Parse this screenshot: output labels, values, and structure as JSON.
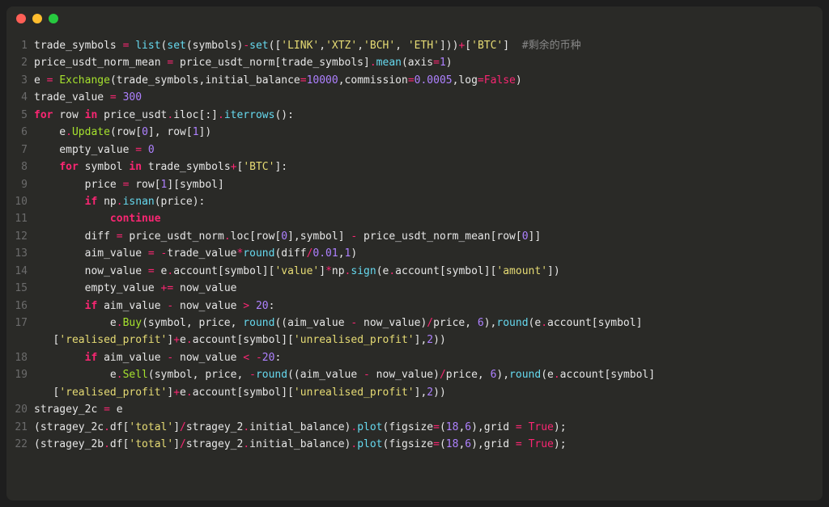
{
  "window": {
    "traffic_lights": [
      "red",
      "yellow",
      "green"
    ]
  },
  "code": {
    "lines": [
      {
        "n": "1",
        "tokens": [
          [
            "var",
            "trade_symbols "
          ],
          [
            "op",
            "="
          ],
          [
            "var",
            " "
          ],
          [
            "func",
            "list"
          ],
          [
            "var",
            "("
          ],
          [
            "func",
            "set"
          ],
          [
            "var",
            "(symbols)"
          ],
          [
            "op",
            "-"
          ],
          [
            "func",
            "set"
          ],
          [
            "var",
            "(["
          ],
          [
            "str",
            "'LINK'"
          ],
          [
            "var",
            ","
          ],
          [
            "str",
            "'XTZ'"
          ],
          [
            "var",
            ","
          ],
          [
            "str",
            "'BCH'"
          ],
          [
            "var",
            ", "
          ],
          [
            "str",
            "'ETH'"
          ],
          [
            "var",
            "]))"
          ],
          [
            "op",
            "+"
          ],
          [
            "var",
            "["
          ],
          [
            "str",
            "'BTC'"
          ],
          [
            "var",
            "]  "
          ],
          [
            "cmnt",
            "#剩余的币种"
          ]
        ]
      },
      {
        "n": "2",
        "tokens": [
          [
            "var",
            "price_usdt_norm_mean "
          ],
          [
            "op",
            "="
          ],
          [
            "var",
            " price_usdt_norm[trade_symbols]"
          ],
          [
            "op",
            "."
          ],
          [
            "func",
            "mean"
          ],
          [
            "var",
            "(axis"
          ],
          [
            "op",
            "="
          ],
          [
            "num",
            "1"
          ],
          [
            "var",
            ")"
          ]
        ]
      },
      {
        "n": "3",
        "tokens": [
          [
            "var",
            "e "
          ],
          [
            "op",
            "="
          ],
          [
            "var",
            " "
          ],
          [
            "class",
            "Exchange"
          ],
          [
            "var",
            "(trade_symbols,initial_balance"
          ],
          [
            "op",
            "="
          ],
          [
            "num",
            "10000"
          ],
          [
            "var",
            ",commission"
          ],
          [
            "op",
            "="
          ],
          [
            "num",
            "0.0005"
          ],
          [
            "var",
            ",log"
          ],
          [
            "op",
            "="
          ],
          [
            "const",
            "False"
          ],
          [
            "var",
            ")"
          ]
        ]
      },
      {
        "n": "4",
        "tokens": [
          [
            "var",
            "trade_value "
          ],
          [
            "op",
            "="
          ],
          [
            "var",
            " "
          ],
          [
            "num",
            "300"
          ]
        ]
      },
      {
        "n": "5",
        "tokens": [
          [
            "kw",
            "for"
          ],
          [
            "var",
            " row "
          ],
          [
            "kw",
            "in"
          ],
          [
            "var",
            " price_usdt"
          ],
          [
            "op",
            "."
          ],
          [
            "var",
            "iloc[:]"
          ],
          [
            "op",
            "."
          ],
          [
            "func",
            "iterrows"
          ],
          [
            "var",
            "():"
          ]
        ]
      },
      {
        "n": "6",
        "tokens": [
          [
            "var",
            "    e"
          ],
          [
            "op",
            "."
          ],
          [
            "class",
            "Update"
          ],
          [
            "var",
            "(row["
          ],
          [
            "num",
            "0"
          ],
          [
            "var",
            "], row["
          ],
          [
            "num",
            "1"
          ],
          [
            "var",
            "])"
          ]
        ]
      },
      {
        "n": "7",
        "tokens": [
          [
            "var",
            "    empty_value "
          ],
          [
            "op",
            "="
          ],
          [
            "var",
            " "
          ],
          [
            "num",
            "0"
          ]
        ]
      },
      {
        "n": "8",
        "tokens": [
          [
            "var",
            "    "
          ],
          [
            "kw",
            "for"
          ],
          [
            "var",
            " symbol "
          ],
          [
            "kw",
            "in"
          ],
          [
            "var",
            " trade_symbols"
          ],
          [
            "op",
            "+"
          ],
          [
            "var",
            "["
          ],
          [
            "str",
            "'BTC'"
          ],
          [
            "var",
            "]:"
          ]
        ]
      },
      {
        "n": "9",
        "tokens": [
          [
            "var",
            "        price "
          ],
          [
            "op",
            "="
          ],
          [
            "var",
            " row["
          ],
          [
            "num",
            "1"
          ],
          [
            "var",
            "][symbol]"
          ]
        ]
      },
      {
        "n": "10",
        "tokens": [
          [
            "var",
            "        "
          ],
          [
            "kw",
            "if"
          ],
          [
            "var",
            " np"
          ],
          [
            "op",
            "."
          ],
          [
            "func",
            "isnan"
          ],
          [
            "var",
            "(price):"
          ]
        ]
      },
      {
        "n": "11",
        "tokens": [
          [
            "var",
            "            "
          ],
          [
            "kw",
            "continue"
          ]
        ]
      },
      {
        "n": "12",
        "tokens": [
          [
            "var",
            "        diff "
          ],
          [
            "op",
            "="
          ],
          [
            "var",
            " price_usdt_norm"
          ],
          [
            "op",
            "."
          ],
          [
            "var",
            "loc[row["
          ],
          [
            "num",
            "0"
          ],
          [
            "var",
            "],symbol] "
          ],
          [
            "op",
            "-"
          ],
          [
            "var",
            " price_usdt_norm_mean[row["
          ],
          [
            "num",
            "0"
          ],
          [
            "var",
            "]]"
          ]
        ]
      },
      {
        "n": "13",
        "tokens": [
          [
            "var",
            "        aim_value "
          ],
          [
            "op",
            "="
          ],
          [
            "var",
            " "
          ],
          [
            "op",
            "-"
          ],
          [
            "var",
            "trade_value"
          ],
          [
            "op",
            "*"
          ],
          [
            "func",
            "round"
          ],
          [
            "var",
            "(diff"
          ],
          [
            "op",
            "/"
          ],
          [
            "num",
            "0.01"
          ],
          [
            "var",
            ","
          ],
          [
            "num",
            "1"
          ],
          [
            "var",
            ")"
          ]
        ]
      },
      {
        "n": "14",
        "tokens": [
          [
            "var",
            "        now_value "
          ],
          [
            "op",
            "="
          ],
          [
            "var",
            " e"
          ],
          [
            "op",
            "."
          ],
          [
            "var",
            "account[symbol]["
          ],
          [
            "str",
            "'value'"
          ],
          [
            "var",
            "]"
          ],
          [
            "op",
            "*"
          ],
          [
            "var",
            "np"
          ],
          [
            "op",
            "."
          ],
          [
            "func",
            "sign"
          ],
          [
            "var",
            "(e"
          ],
          [
            "op",
            "."
          ],
          [
            "var",
            "account[symbol]["
          ],
          [
            "str",
            "'amount'"
          ],
          [
            "var",
            "])"
          ]
        ]
      },
      {
        "n": "15",
        "tokens": [
          [
            "var",
            "        empty_value "
          ],
          [
            "op",
            "+="
          ],
          [
            "var",
            " now_value"
          ]
        ]
      },
      {
        "n": "16",
        "tokens": [
          [
            "var",
            "        "
          ],
          [
            "kw",
            "if"
          ],
          [
            "var",
            " aim_value "
          ],
          [
            "op",
            "-"
          ],
          [
            "var",
            " now_value "
          ],
          [
            "op",
            ">"
          ],
          [
            "var",
            " "
          ],
          [
            "num",
            "20"
          ],
          [
            "var",
            ":"
          ]
        ]
      },
      {
        "n": "17",
        "tokens": [
          [
            "var",
            "            e"
          ],
          [
            "op",
            "."
          ],
          [
            "class",
            "Buy"
          ],
          [
            "var",
            "(symbol, price, "
          ],
          [
            "func",
            "round"
          ],
          [
            "var",
            "((aim_value "
          ],
          [
            "op",
            "-"
          ],
          [
            "var",
            " now_value)"
          ],
          [
            "op",
            "/"
          ],
          [
            "var",
            "price, "
          ],
          [
            "num",
            "6"
          ],
          [
            "var",
            "),"
          ],
          [
            "func",
            "round"
          ],
          [
            "var",
            "(e"
          ],
          [
            "op",
            "."
          ],
          [
            "var",
            "account[symbol]"
          ]
        ]
      },
      {
        "n": "",
        "tokens": [
          [
            "var",
            "   ["
          ],
          [
            "str",
            "'realised_profit'"
          ],
          [
            "var",
            "]"
          ],
          [
            "op",
            "+"
          ],
          [
            "var",
            "e"
          ],
          [
            "op",
            "."
          ],
          [
            "var",
            "account[symbol]["
          ],
          [
            "str",
            "'unrealised_profit'"
          ],
          [
            "var",
            "],"
          ],
          [
            "num",
            "2"
          ],
          [
            "var",
            "))"
          ]
        ]
      },
      {
        "n": "18",
        "tokens": [
          [
            "var",
            "        "
          ],
          [
            "kw",
            "if"
          ],
          [
            "var",
            " aim_value "
          ],
          [
            "op",
            "-"
          ],
          [
            "var",
            " now_value "
          ],
          [
            "op",
            "<"
          ],
          [
            "var",
            " "
          ],
          [
            "op",
            "-"
          ],
          [
            "num",
            "20"
          ],
          [
            "var",
            ":"
          ]
        ]
      },
      {
        "n": "19",
        "tokens": [
          [
            "var",
            "            e"
          ],
          [
            "op",
            "."
          ],
          [
            "class",
            "Sell"
          ],
          [
            "var",
            "(symbol, price, "
          ],
          [
            "op",
            "-"
          ],
          [
            "func",
            "round"
          ],
          [
            "var",
            "((aim_value "
          ],
          [
            "op",
            "-"
          ],
          [
            "var",
            " now_value)"
          ],
          [
            "op",
            "/"
          ],
          [
            "var",
            "price, "
          ],
          [
            "num",
            "6"
          ],
          [
            "var",
            "),"
          ],
          [
            "func",
            "round"
          ],
          [
            "var",
            "(e"
          ],
          [
            "op",
            "."
          ],
          [
            "var",
            "account[symbol]"
          ]
        ]
      },
      {
        "n": "",
        "tokens": [
          [
            "var",
            "   ["
          ],
          [
            "str",
            "'realised_profit'"
          ],
          [
            "var",
            "]"
          ],
          [
            "op",
            "+"
          ],
          [
            "var",
            "e"
          ],
          [
            "op",
            "."
          ],
          [
            "var",
            "account[symbol]["
          ],
          [
            "str",
            "'unrealised_profit'"
          ],
          [
            "var",
            "],"
          ],
          [
            "num",
            "2"
          ],
          [
            "var",
            "))"
          ]
        ]
      },
      {
        "n": "20",
        "tokens": [
          [
            "var",
            "stragey_2c "
          ],
          [
            "op",
            "="
          ],
          [
            "var",
            " e"
          ]
        ]
      },
      {
        "n": "21",
        "tokens": [
          [
            "var",
            "(stragey_2c"
          ],
          [
            "op",
            "."
          ],
          [
            "var",
            "df["
          ],
          [
            "str",
            "'total'"
          ],
          [
            "var",
            "]"
          ],
          [
            "op",
            "/"
          ],
          [
            "var",
            "stragey_2"
          ],
          [
            "op",
            "."
          ],
          [
            "var",
            "initial_balance)"
          ],
          [
            "op",
            "."
          ],
          [
            "func",
            "plot"
          ],
          [
            "var",
            "(figsize"
          ],
          [
            "op",
            "="
          ],
          [
            "var",
            "("
          ],
          [
            "num",
            "18"
          ],
          [
            "var",
            ","
          ],
          [
            "num",
            "6"
          ],
          [
            "var",
            "),grid "
          ],
          [
            "op",
            "="
          ],
          [
            "var",
            " "
          ],
          [
            "const",
            "True"
          ],
          [
            "var",
            ");"
          ]
        ]
      },
      {
        "n": "22",
        "tokens": [
          [
            "var",
            "(stragey_2b"
          ],
          [
            "op",
            "."
          ],
          [
            "var",
            "df["
          ],
          [
            "str",
            "'total'"
          ],
          [
            "var",
            "]"
          ],
          [
            "op",
            "/"
          ],
          [
            "var",
            "stragey_2"
          ],
          [
            "op",
            "."
          ],
          [
            "var",
            "initial_balance)"
          ],
          [
            "op",
            "."
          ],
          [
            "func",
            "plot"
          ],
          [
            "var",
            "(figsize"
          ],
          [
            "op",
            "="
          ],
          [
            "var",
            "("
          ],
          [
            "num",
            "18"
          ],
          [
            "var",
            ","
          ],
          [
            "num",
            "6"
          ],
          [
            "var",
            "),grid "
          ],
          [
            "op",
            "="
          ],
          [
            "var",
            " "
          ],
          [
            "const",
            "True"
          ],
          [
            "var",
            ");"
          ]
        ]
      }
    ]
  }
}
